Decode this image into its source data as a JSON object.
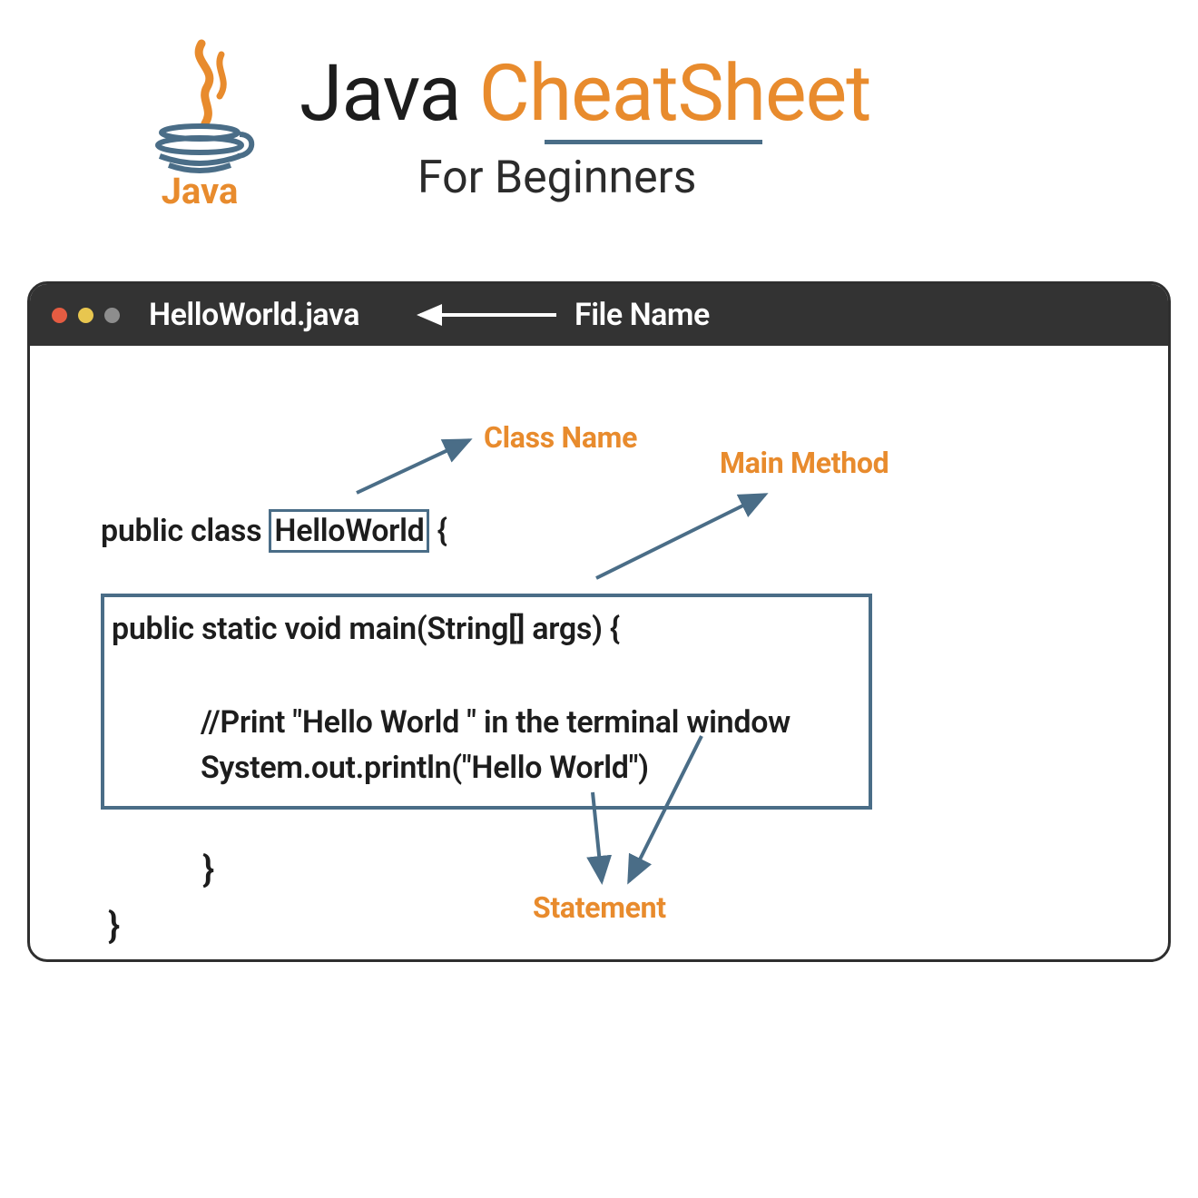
{
  "header": {
    "title_part1": "Java ",
    "title_part2": "CheatSheet",
    "subtitle": "For Beginners",
    "logo_label": "Java"
  },
  "window": {
    "file_name": "HelloWorld.java",
    "file_label": "File Name"
  },
  "annotations": {
    "class_name": "Class Name",
    "main_method": "Main Method",
    "statement": "Statement"
  },
  "code": {
    "line1_pre": "public class",
    "line1_classname": "HelloWorld",
    "line1_post": " {",
    "main_signature": "public static void main(String[] args) {",
    "comment": "//Print \"Hello World \" in the terminal window",
    "println": "System.out.println(\"Hello World\")",
    "close_inner": "}",
    "close_outer": "}"
  },
  "colors": {
    "accent_orange": "#e88b2d",
    "accent_blue": "#4a6d87",
    "window_chrome": "#333333"
  }
}
